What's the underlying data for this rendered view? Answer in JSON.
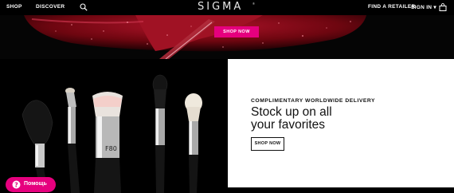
{
  "header": {
    "nav": [
      {
        "label": "SHOP"
      },
      {
        "label": "DISCOVER"
      }
    ],
    "logo": "SIGMA",
    "logo_mark": "®",
    "find_retailer": "FIND A RETAILER",
    "sign_in": "SIGN IN ▾"
  },
  "hero": {
    "button_label": "SHOP NOW"
  },
  "promo": {
    "eyebrow": "COMPLIMENTARY WORLDWIDE DELIVERY",
    "headline_line1": "Stock up on all",
    "headline_line2": "your favorites",
    "button_label": "SHOP NOW"
  },
  "help": {
    "label": "Помощь"
  },
  "colors": {
    "accent": "#e6007e",
    "background": "#000000",
    "panel": "#ffffff",
    "hero_red": "#8a0a14"
  },
  "icons": [
    "search-icon",
    "cart-icon",
    "help-icon"
  ]
}
